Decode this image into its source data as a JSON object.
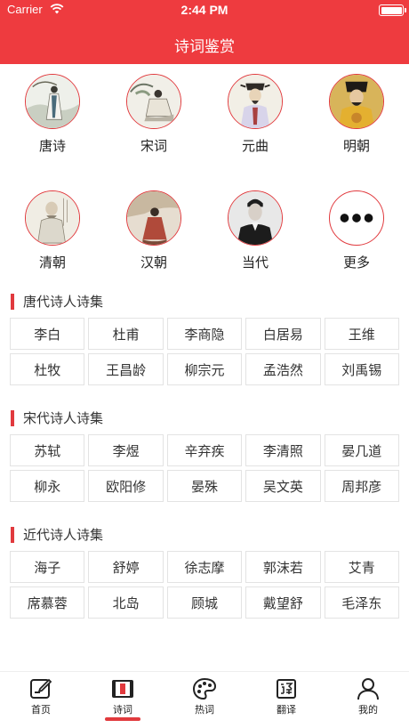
{
  "status_bar": {
    "carrier": "Carrier",
    "time": "2:44 PM"
  },
  "header": {
    "title": "诗词鉴赏"
  },
  "categories": [
    {
      "label": "唐诗",
      "icon": "tang-poet-portrait"
    },
    {
      "label": "宋词",
      "icon": "song-poet-portrait"
    },
    {
      "label": "元曲",
      "icon": "yuan-poet-portrait"
    },
    {
      "label": "明朝",
      "icon": "ming-emperor-portrait"
    },
    {
      "label": "清朝",
      "icon": "qing-scholar-portrait"
    },
    {
      "label": "汉朝",
      "icon": "han-figure-portrait"
    },
    {
      "label": "当代",
      "icon": "modern-poet-photo"
    },
    {
      "label": "更多",
      "icon": "more-dots-icon"
    }
  ],
  "sections": [
    {
      "title": "唐代诗人诗集",
      "poets": [
        "李白",
        "杜甫",
        "李商隐",
        "白居易",
        "王维",
        "杜牧",
        "王昌龄",
        "柳宗元",
        "孟浩然",
        "刘禹锡"
      ]
    },
    {
      "title": "宋代诗人诗集",
      "poets": [
        "苏轼",
        "李煜",
        "辛弃疾",
        "李清照",
        "晏几道",
        "柳永",
        "欧阳修",
        "晏殊",
        "吴文英",
        "周邦彦"
      ]
    },
    {
      "title": "近代诗人诗集",
      "poets": [
        "海子",
        "舒婷",
        "徐志摩",
        "郭沫若",
        "艾青",
        "席慕蓉",
        "北岛",
        "顾城",
        "戴望舒",
        "毛泽东"
      ]
    }
  ],
  "tabbar": {
    "selected": "诗词",
    "tabs": [
      {
        "label": "首页",
        "icon": "home-edit-icon"
      },
      {
        "label": "诗词",
        "icon": "scroll-icon"
      },
      {
        "label": "热词",
        "icon": "palette-icon"
      },
      {
        "label": "翻译",
        "icon": "translate-icon"
      },
      {
        "label": "我的",
        "icon": "profile-icon"
      }
    ]
  },
  "colors": {
    "accent": "#ee3b3f"
  }
}
